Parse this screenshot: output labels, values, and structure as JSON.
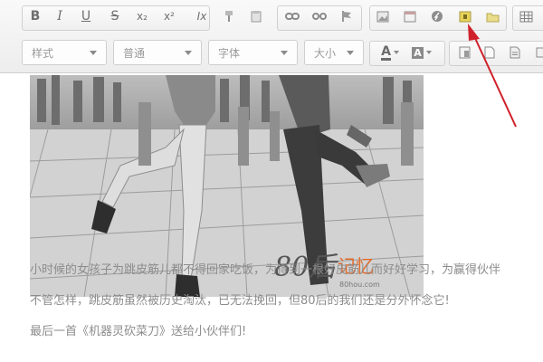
{
  "toolbar": {
    "row1": [
      {
        "name": "bold-icon",
        "glyph": "B"
      },
      {
        "name": "italic-icon",
        "glyph": "I"
      },
      {
        "name": "underline-icon",
        "glyph": "U"
      },
      {
        "name": "strikethrough-icon",
        "glyph": "S"
      },
      {
        "name": "subscript-icon",
        "glyph": "x₂"
      },
      {
        "name": "superscript-icon",
        "glyph": "x²"
      },
      {
        "name": "clear-format-icon",
        "glyph": "Ix"
      },
      {
        "name": "format-painter-icon",
        "glyph": ""
      },
      {
        "name": "paste-text-icon",
        "glyph": ""
      },
      {
        "name": "link-icon",
        "glyph": ""
      },
      {
        "name": "unlink-icon",
        "glyph": ""
      },
      {
        "name": "anchor-flag-icon",
        "glyph": ""
      },
      {
        "name": "image-icon",
        "glyph": ""
      },
      {
        "name": "calendar-icon",
        "glyph": ""
      },
      {
        "name": "flash-icon",
        "glyph": ""
      },
      {
        "name": "insert-image-icon",
        "glyph": ""
      },
      {
        "name": "folder-icon",
        "glyph": ""
      },
      {
        "name": "table-icon",
        "glyph": ""
      }
    ],
    "combos": {
      "style": "样式",
      "format": "普通",
      "font": "字体",
      "size": "大小"
    },
    "text_color_glyph": "A",
    "bg_color_glyph": "A"
  },
  "content": {
    "watermark_main": "80后",
    "watermark_accent": "记忆",
    "watermark_site": "80hou.com",
    "paragraphs": [
      "小时候的女孩子为跳皮筋儿都不得回家吃饭，为得到一根好皮筋儿而好好学习，为赢得伙伴",
      "不管怎样，跳皮筋虽然被历史淘汰，已无法挽回，但80后的我们还是分外怀念它!",
      "最后一首《机器灵砍菜刀》送给小伙伴们!"
    ]
  },
  "colors": {
    "annotation_arrow": "#d0212a",
    "highlight_icon": "#e8d35a"
  }
}
